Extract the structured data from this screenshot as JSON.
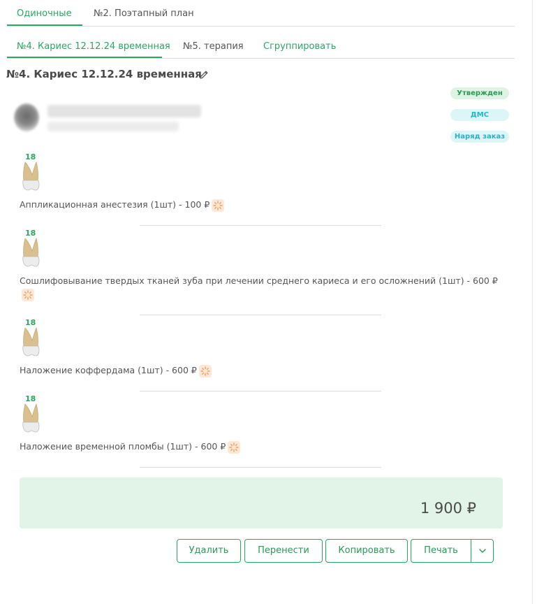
{
  "tabs_level1": [
    {
      "label": "Одиночные",
      "active": true
    },
    {
      "label": "№2. Поэтапный план",
      "active": false
    }
  ],
  "tabs_level2": [
    {
      "label": "№4. Кариес 12.12.24 временная",
      "active": true
    },
    {
      "label": "№5. терапия",
      "active": false
    },
    {
      "label": "Сгруппировать",
      "active": false
    }
  ],
  "visit": {
    "title": "№4. Кариес 12.12.24 временная",
    "edit_icon": "pencil-icon"
  },
  "badges": [
    {
      "label": "Утвержден",
      "color": "#2a9a55"
    },
    {
      "label": "ДМС",
      "color": "#1fb7c6"
    },
    {
      "label": "Наряд заказ",
      "color": "#1fb7c6"
    }
  ],
  "services": [
    {
      "tooth": "18",
      "text": "Аппликационная анестезия (1шт) - 100 ₽"
    },
    {
      "tooth": "18",
      "text": "Сошлифовывание твердых тканей зуба при лечении среднего кариеса и его осложнений (1шт) - 600 ₽"
    },
    {
      "tooth": "18",
      "text": "Наложение коффердама (1шт) - 600 ₽"
    },
    {
      "tooth": "18",
      "text": "Наложение временной пломбы (1шт) - 600 ₽"
    }
  ],
  "total": "1 900 ₽",
  "buttons": {
    "delete": "Удалить",
    "move": "Перенести",
    "copy": "Копировать",
    "print": "Печать"
  },
  "colors": {
    "accent": "#2aa760",
    "total_bg": "#e2f4e8",
    "gear_bg": "#fde7d6"
  }
}
